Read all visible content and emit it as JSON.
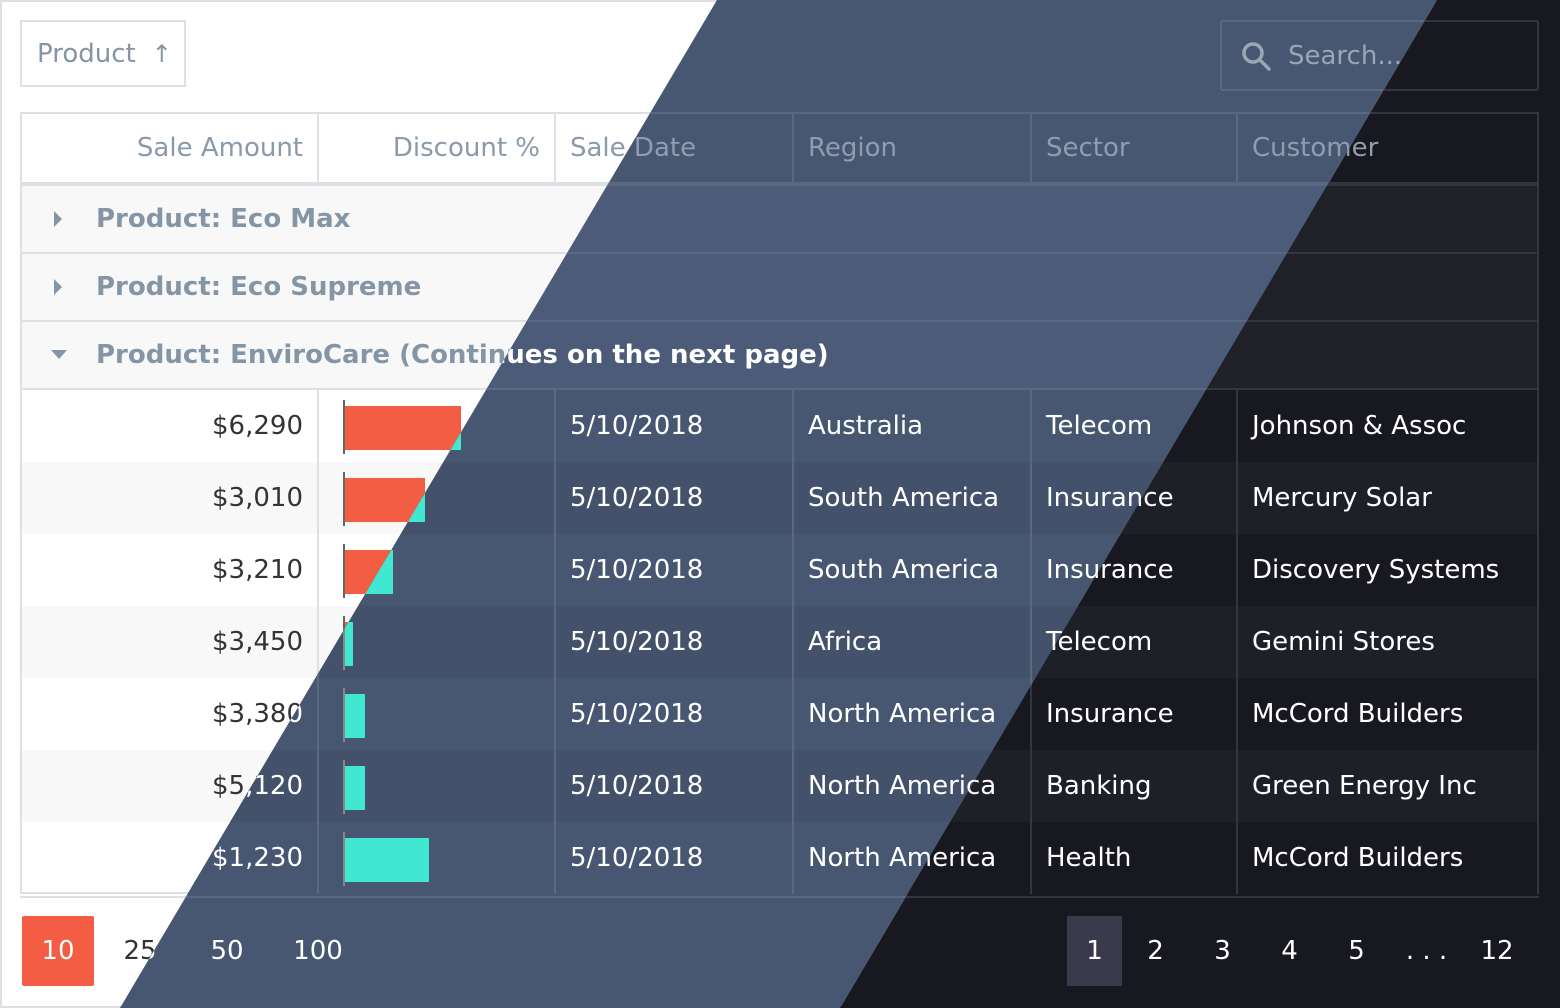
{
  "toolbar": {
    "group_chip": {
      "label": "Product",
      "sort_icon": "arrow-up-icon"
    },
    "search": {
      "placeholder": "Search...",
      "icon": "search-icon"
    }
  },
  "columns": [
    {
      "key": "amount",
      "label": "Sale Amount",
      "align": "right"
    },
    {
      "key": "discount",
      "label": "Discount %",
      "align": "right"
    },
    {
      "key": "date",
      "label": "Sale Date",
      "align": "left"
    },
    {
      "key": "region",
      "label": "Region",
      "align": "left"
    },
    {
      "key": "sector",
      "label": "Sector",
      "align": "left"
    },
    {
      "key": "customer",
      "label": "Customer",
      "align": "left"
    }
  ],
  "groups": [
    {
      "label": "Product: Eco Max",
      "expanded": false
    },
    {
      "label": "Product: Eco Supreme",
      "expanded": false
    },
    {
      "label": "Product: EnviroCare (Continues on the next page)",
      "expanded": true
    }
  ],
  "rows": [
    {
      "amount": "$6,290",
      "discount": 0.29,
      "date": "5/10/2018",
      "region": "Australia",
      "sector": "Telecom",
      "customer": "Johnson & Assoc"
    },
    {
      "amount": "$3,010",
      "discount": 0.2,
      "date": "5/10/2018",
      "region": "South America",
      "sector": "Insurance",
      "customer": "Mercury Solar"
    },
    {
      "amount": "$3,210",
      "discount": 0.12,
      "date": "5/10/2018",
      "region": "South America",
      "sector": "Insurance",
      "customer": "Discovery Systems"
    },
    {
      "amount": "$3,450",
      "discount": 0.02,
      "date": "5/10/2018",
      "region": "Africa",
      "sector": "Telecom",
      "customer": "Gemini Stores"
    },
    {
      "amount": "$3,380",
      "discount": 0.05,
      "date": "5/10/2018",
      "region": "North America",
      "sector": "Insurance",
      "customer": "McCord Builders"
    },
    {
      "amount": "$5,120",
      "discount": 0.05,
      "date": "5/10/2018",
      "region": "North America",
      "sector": "Banking",
      "customer": "Green Energy Inc"
    },
    {
      "amount": "$1,230",
      "discount": 0.21,
      "date": "5/10/2018",
      "region": "North America",
      "sector": "Health",
      "customer": "McCord Builders"
    }
  ],
  "pager": {
    "page_sizes": [
      "10",
      "25",
      "50",
      "100"
    ],
    "selected_page_size": "10",
    "pages": [
      "1",
      "2",
      "3",
      "4",
      "5",
      ". . .",
      "12"
    ],
    "current_page": "1"
  },
  "colors": {
    "accent": "#f25d44",
    "bar_light": "#f25d44",
    "bar_dark": "#40e8d2",
    "light_bg": "#ffffff",
    "blue_bg": "#475671",
    "dark_bg": "#181820"
  }
}
